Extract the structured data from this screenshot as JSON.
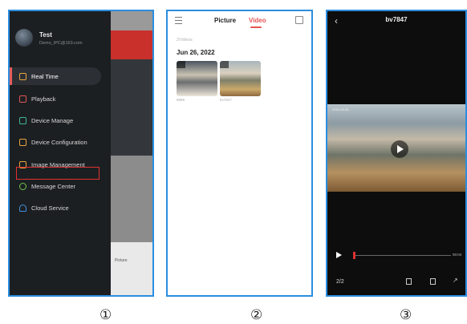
{
  "panel1": {
    "user": {
      "name": "Test",
      "email": "Demo_IPC@163.com"
    },
    "menu": [
      {
        "label": "Real Time",
        "icon": "play-square-icon",
        "active": true
      },
      {
        "label": "Playback",
        "icon": "playback-icon",
        "active": false
      },
      {
        "label": "Device Manage",
        "icon": "camera-icon",
        "active": false
      },
      {
        "label": "Device Configuration",
        "icon": "settings-square-icon",
        "active": false
      },
      {
        "label": "Image Management",
        "icon": "image-icon",
        "active": false
      },
      {
        "label": "Message Center",
        "icon": "message-icon",
        "active": false
      },
      {
        "label": "Cloud Service",
        "icon": "cloud-icon",
        "active": false
      }
    ],
    "background_footer_label": "Picture",
    "highlight_color": "#e03131"
  },
  "panel2": {
    "tabs": [
      "Picture",
      "Video"
    ],
    "active_tab": "Video",
    "count_label": "2Videos",
    "date": "Jun 26, 2022",
    "thumbs": [
      {
        "caption": "9999"
      },
      {
        "caption": "bv7847"
      }
    ]
  },
  "panel3": {
    "title": "bv7847",
    "video_stamp": "2022-06-26",
    "time": "00:04",
    "page": "2/2"
  },
  "captions": [
    "①",
    "②",
    "③"
  ],
  "colors": {
    "panel_border": "#2b8ee0",
    "accent_red": "#e25555"
  }
}
